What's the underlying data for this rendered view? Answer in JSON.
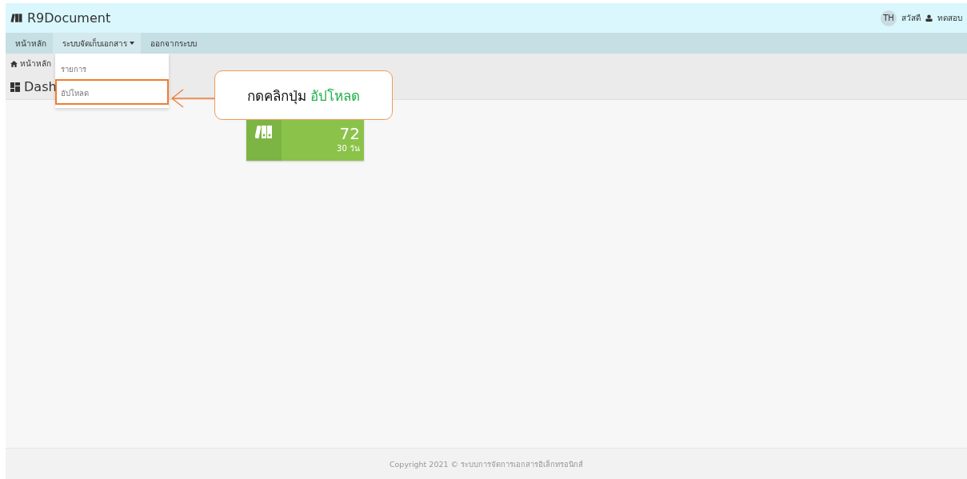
{
  "brand": {
    "title": "R9Document"
  },
  "user": {
    "initials": "TH",
    "greeting": "สวัสดี",
    "name": "ทดสอบ"
  },
  "nav": [
    {
      "label": "หน้าหลัก",
      "selected": false,
      "has_caret": false
    },
    {
      "label": "ระบบจัดเก็บเอกสาร",
      "selected": true,
      "has_caret": true
    },
    {
      "label": "ออกจากระบบ",
      "selected": false,
      "has_caret": false
    }
  ],
  "dropdown": [
    {
      "label": "รายการ",
      "selected": false
    },
    {
      "label": "อัปโหลด",
      "selected": true
    }
  ],
  "breadcrumb": "หน้าหลัก",
  "page_title": "Dash",
  "tile": {
    "value": "72",
    "period": "30 วัน"
  },
  "callout": "กดคลิกปุ่ม **อัปโหลด**",
  "footer": "Copyright 2021 © ระบบการจัดการเอกสารอิเล็กทรอนิกส์"
}
